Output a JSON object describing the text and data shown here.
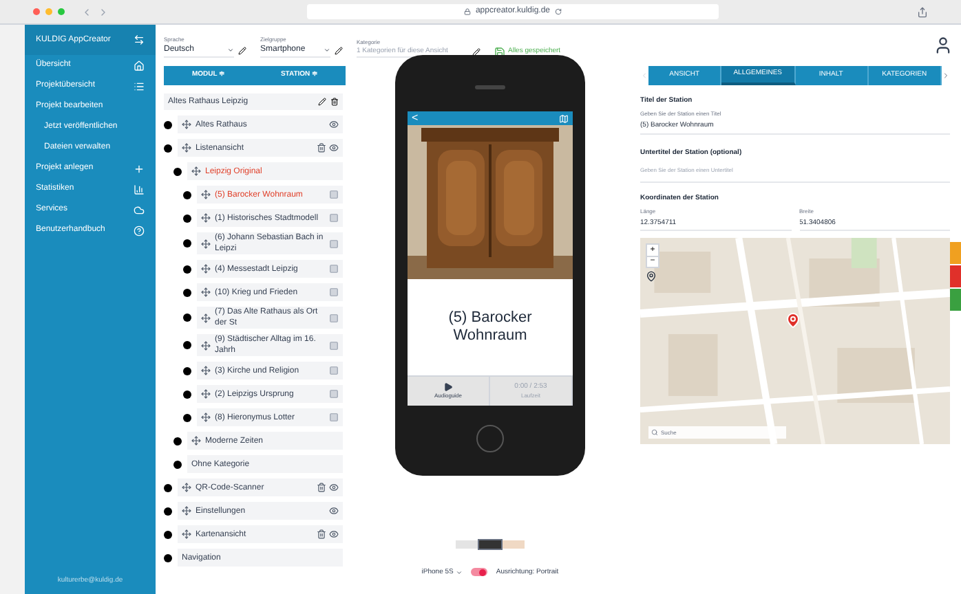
{
  "browser": {
    "address": "appcreator.kuldig.de"
  },
  "sidebar": {
    "title": "KULDIG AppCreator",
    "items": [
      {
        "label": "Übersicht",
        "kind": "home",
        "sub": false
      },
      {
        "label": "Projektübersicht",
        "kind": "list",
        "sub": false
      },
      {
        "label": "Projekt bearbeiten",
        "kind": "none",
        "sub": false
      },
      {
        "label": "Jetzt veröffentlichen",
        "kind": "none",
        "sub": true
      },
      {
        "label": "Dateien verwalten",
        "kind": "none",
        "sub": true
      },
      {
        "label": "Projekt anlegen",
        "kind": "plus",
        "sub": false
      },
      {
        "label": "Statistiken",
        "kind": "chart",
        "sub": false
      },
      {
        "label": "Services",
        "kind": "cloud",
        "sub": false
      },
      {
        "label": "Benutzerhandbuch",
        "kind": "help",
        "sub": false
      }
    ],
    "footer": "kulturerbe@kuldig.de"
  },
  "toolbar": {
    "selects": [
      {
        "label": "Sprache",
        "value": "Deutsch"
      },
      {
        "label": "Zielgruppe",
        "value": "Smartphone"
      }
    ],
    "category": {
      "label": "Kategorie",
      "placeholder": "1 Kategorien für diese Ansicht"
    },
    "save_status": "Alles gespeichert"
  },
  "tree": {
    "columns": [
      "MODUL ≑",
      "STATION ≑"
    ],
    "project": "Altes Rathaus Leipzig",
    "items": [
      {
        "label": "Altes Rathaus",
        "kind": "page",
        "selected": false
      },
      {
        "label": "Listenansicht",
        "kind": "list",
        "selected": false,
        "children": [
          {
            "label": "Leipzig Original",
            "kind": "category",
            "selected": true,
            "children": [
              {
                "label": "(5) Barocker Wohnraum",
                "kind": "station",
                "selected": true
              },
              {
                "label": "(1) Historisches Stadtmodell",
                "kind": "station",
                "selected": false
              },
              {
                "label": "(6) Johann Sebastian Bach in Leipzi",
                "kind": "station",
                "selected": false
              },
              {
                "label": "(4) Messestadt Leipzig",
                "kind": "station",
                "selected": false
              },
              {
                "label": "(10) Krieg und Frieden",
                "kind": "station",
                "selected": false
              },
              {
                "label": "(7) Das Alte Rathaus als Ort der St",
                "kind": "station",
                "selected": false
              },
              {
                "label": "(9) Städtischer Alltag im 16. Jahrh",
                "kind": "station",
                "selected": false
              },
              {
                "label": "(3) Kirche und Religion",
                "kind": "station",
                "selected": false
              },
              {
                "label": "(2) Leipzigs Ursprung",
                "kind": "station",
                "selected": false
              },
              {
                "label": "(8) Hieronymus Lotter",
                "kind": "station",
                "selected": false
              }
            ]
          },
          {
            "label": "Moderne Zeiten",
            "kind": "category",
            "selected": false
          },
          {
            "label": "Ohne Kategorie",
            "kind": "plain",
            "selected": false
          }
        ]
      },
      {
        "label": "QR-Code-Scanner",
        "kind": "list",
        "selected": false
      },
      {
        "label": "Einstellungen",
        "kind": "page",
        "selected": false
      },
      {
        "label": "Kartenansicht",
        "kind": "list",
        "selected": false
      },
      {
        "label": "Navigation",
        "kind": "plain",
        "selected": false
      }
    ]
  },
  "phone": {
    "back": "<",
    "title": "(5) Barocker Wohnraum",
    "buttons": [
      {
        "label": "Audioguide",
        "kind": "play",
        "disabled": false
      },
      {
        "label": "Laufzeit",
        "kind": "time",
        "value": "0:00 / 2:53",
        "disabled": true
      }
    ]
  },
  "preview": {
    "swatches": [
      {
        "color": "#e4e4e4",
        "selected": false
      },
      {
        "color": "#333333",
        "selected": true
      },
      {
        "color": "#f0d9c4",
        "selected": false
      }
    ],
    "device": "iPhone 5S",
    "orientation": {
      "label": "Ausrichtung: Portrait",
      "on": true
    }
  },
  "tabs": [
    {
      "label": "ANSICHT",
      "selected": false
    },
    {
      "label": "ALLGEMEINES",
      "selected": true
    },
    {
      "label": "INHALT",
      "selected": false
    },
    {
      "label": "KATEGORIEN",
      "selected": false
    }
  ],
  "form": {
    "title": {
      "label": "Titel der Station",
      "hint": "Geben Sie der Station einen Titel",
      "value": "(5) Barocker Wohnraum"
    },
    "subtitle": {
      "label": "Untertitel der Station (optional)",
      "placeholder": "Geben Sie der Station einen Untertitel"
    },
    "coords": {
      "label": "Koordinaten der Station",
      "fields": [
        {
          "label": "Länge",
          "value": "12.3754711"
        },
        {
          "label": "Breite",
          "value": "51.3404806"
        }
      ]
    }
  },
  "map": {
    "zoom_in": "+",
    "zoom_out": "−",
    "search_placeholder": "Suche"
  },
  "side_tabs": [
    {
      "color": "#f0a020"
    },
    {
      "color": "#e0302a"
    },
    {
      "color": "#3aa040"
    }
  ]
}
